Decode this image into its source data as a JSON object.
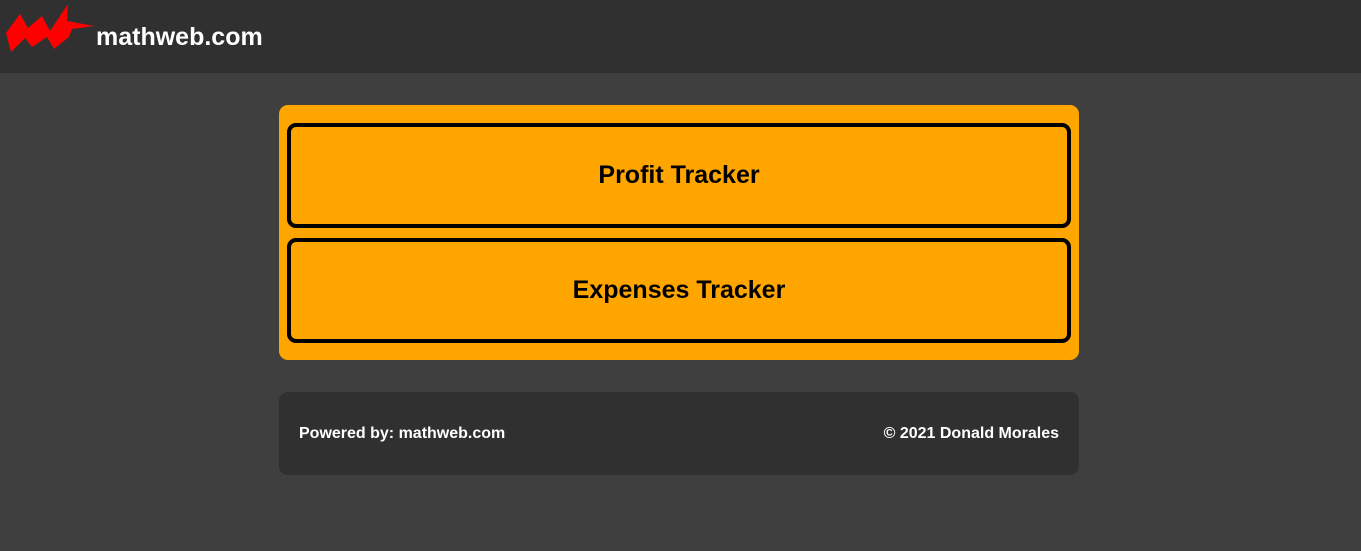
{
  "header": {
    "logo_icon": "red-lightning-bolt-icon",
    "logo_color": "#ff0000",
    "site_name": "mathweb.com",
    "background": "#303030"
  },
  "main": {
    "panel_color": "#ffa500",
    "buttons": [
      {
        "label": "Profit Tracker"
      },
      {
        "label": "Expenses Tracker"
      }
    ]
  },
  "footer": {
    "powered_by_prefix": "Powered by: ",
    "powered_by_link": "mathweb.com",
    "copyright": "© 2021 Donald Morales"
  },
  "page": {
    "background": "#3f3f3f"
  }
}
